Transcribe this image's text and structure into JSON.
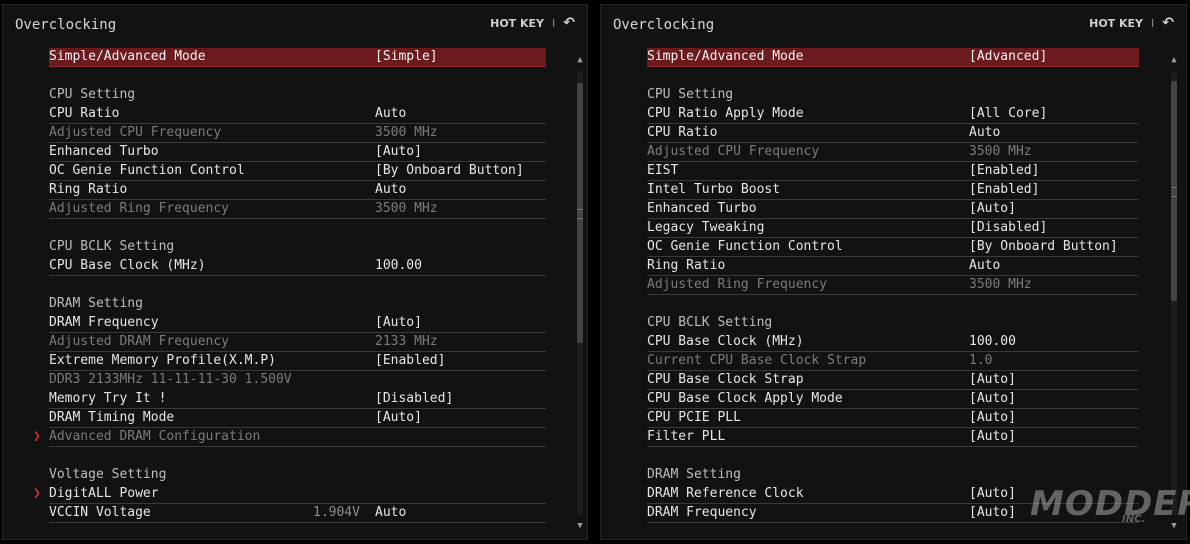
{
  "hotkey_label": "HOT KEY",
  "hotkey_sep": "I",
  "back_glyph": "↶",
  "colors": {
    "selected": "#6c1a1d",
    "arrow": "#d0302c",
    "dim": "#7b7b7b",
    "background": "#121212"
  },
  "left": {
    "title": "Overclocking",
    "rows": [
      {
        "type": "item",
        "selected": true,
        "label": "Simple/Advanced Mode",
        "value": "[Simple]"
      },
      {
        "type": "gap"
      },
      {
        "type": "section",
        "label": "CPU Setting"
      },
      {
        "type": "item",
        "label": "CPU Ratio",
        "value": "Auto"
      },
      {
        "type": "item",
        "dim": true,
        "label": "Adjusted CPU Frequency",
        "value": "3500 MHz"
      },
      {
        "type": "item",
        "label": "Enhanced Turbo",
        "value": "[Auto]"
      },
      {
        "type": "item",
        "label": "OC Genie Function Control",
        "value": "[By Onboard Button]"
      },
      {
        "type": "item",
        "label": "Ring Ratio",
        "value": "Auto"
      },
      {
        "type": "item",
        "dim": true,
        "label": "Adjusted Ring Frequency",
        "value": "3500 MHz"
      },
      {
        "type": "gap"
      },
      {
        "type": "section",
        "label": "CPU BCLK Setting"
      },
      {
        "type": "item",
        "label": "CPU Base Clock (MHz)",
        "value": "100.00"
      },
      {
        "type": "gap"
      },
      {
        "type": "section",
        "label": "DRAM Setting"
      },
      {
        "type": "item",
        "label": "DRAM Frequency",
        "value": "[Auto]"
      },
      {
        "type": "item",
        "dim": true,
        "label": "Adjusted DRAM Frequency",
        "value": "2133 MHz"
      },
      {
        "type": "item",
        "label": "Extreme Memory Profile(X.M.P)",
        "value": "[Enabled]"
      },
      {
        "type": "text",
        "dim": true,
        "label": "DDR3 2133MHz 11-11-11-30 1.500V"
      },
      {
        "type": "item",
        "label": "Memory Try It !",
        "value": "[Disabled]"
      },
      {
        "type": "item",
        "label": "DRAM Timing Mode",
        "value": "[Auto]"
      },
      {
        "type": "item",
        "dim": true,
        "arrow": true,
        "label": "Advanced DRAM Configuration"
      },
      {
        "type": "gap"
      },
      {
        "type": "section",
        "label": "Voltage Setting"
      },
      {
        "type": "item",
        "arrow": true,
        "label": "DigitALL Power"
      },
      {
        "type": "item",
        "label": "VCCIN Voltage",
        "extra": "1.904V",
        "value": "Auto"
      }
    ]
  },
  "right": {
    "title": "Overclocking",
    "rows": [
      {
        "type": "item",
        "selected": true,
        "label": "Simple/Advanced Mode",
        "value": "[Advanced]"
      },
      {
        "type": "gap"
      },
      {
        "type": "section",
        "label": "CPU Setting"
      },
      {
        "type": "item",
        "label": "CPU Ratio Apply Mode",
        "value": "[All Core]"
      },
      {
        "type": "item",
        "label": "CPU Ratio",
        "value": "Auto"
      },
      {
        "type": "item",
        "dim": true,
        "label": "Adjusted CPU Frequency",
        "value": "3500 MHz"
      },
      {
        "type": "item",
        "label": "EIST",
        "value": "[Enabled]"
      },
      {
        "type": "item",
        "label": "Intel Turbo Boost",
        "value": "[Enabled]"
      },
      {
        "type": "item",
        "label": "Enhanced Turbo",
        "value": "[Auto]"
      },
      {
        "type": "item",
        "label": "Legacy Tweaking",
        "value": "[Disabled]"
      },
      {
        "type": "item",
        "label": "OC Genie Function Control",
        "value": "[By Onboard Button]"
      },
      {
        "type": "item",
        "label": "Ring Ratio",
        "value": "Auto"
      },
      {
        "type": "item",
        "dim": true,
        "label": "Adjusted Ring Frequency",
        "value": "3500 MHz"
      },
      {
        "type": "gap"
      },
      {
        "type": "section",
        "label": "CPU BCLK Setting"
      },
      {
        "type": "item",
        "label": "CPU Base Clock (MHz)",
        "value": "100.00"
      },
      {
        "type": "item",
        "dim": true,
        "label": "Current CPU Base Clock Strap",
        "value": "1.0"
      },
      {
        "type": "item",
        "label": "CPU Base Clock Strap",
        "value": "[Auto]"
      },
      {
        "type": "item",
        "label": "CPU Base Clock Apply Mode",
        "value": "[Auto]"
      },
      {
        "type": "item",
        "label": "CPU PCIE PLL",
        "value": "[Auto]"
      },
      {
        "type": "item",
        "label": "Filter PLL",
        "value": "[Auto]"
      },
      {
        "type": "gap"
      },
      {
        "type": "section",
        "label": "DRAM Setting"
      },
      {
        "type": "item",
        "label": "DRAM Reference Clock",
        "value": "[Auto]"
      },
      {
        "type": "item",
        "label": "DRAM Frequency",
        "value": "[Auto]"
      }
    ]
  },
  "watermark": {
    "main": "MODDERS",
    "sub": "INC."
  }
}
